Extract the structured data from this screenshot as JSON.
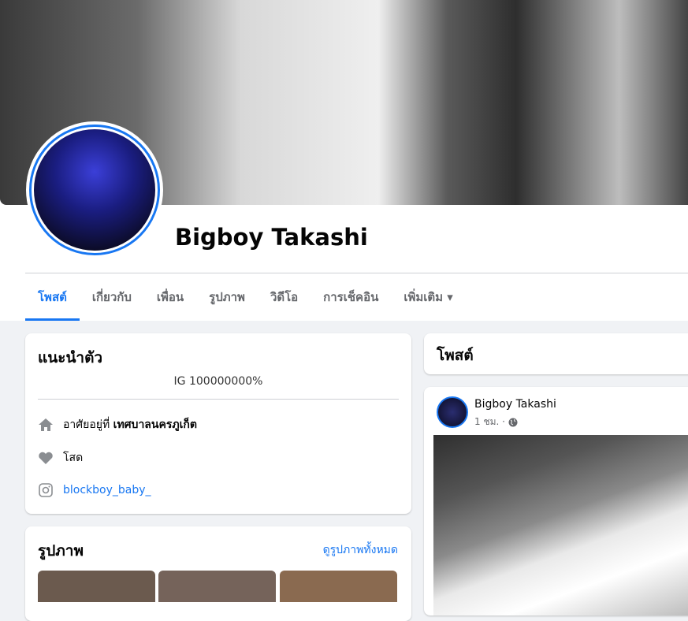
{
  "profile": {
    "name": "Bigboy Takashi"
  },
  "tabs": [
    {
      "label": "โพสต์"
    },
    {
      "label": "เกี่ยวกับ"
    },
    {
      "label": "เพื่อน"
    },
    {
      "label": "รูปภาพ"
    },
    {
      "label": "วิดีโอ"
    },
    {
      "label": "การเช็คอิน"
    },
    {
      "label": "เพิ่มเติม ▾"
    }
  ],
  "intro": {
    "title": "แนะนำตัว",
    "bio": "IG 100000000%",
    "lives_prefix": "อาศัยอยู่ที่ ",
    "lives_place": "เทศบาลนครภูเก็ต",
    "relationship": "โสด",
    "instagram": "blockboy_baby_"
  },
  "photos": {
    "title": "รูปภาพ",
    "see_all": "ดูรูปภาพทั้งหมด"
  },
  "posts": {
    "title": "โพสต์"
  },
  "post": {
    "author": "Bigboy Takashi",
    "time": "1 ชม. ·"
  },
  "colors": {
    "accent": "#1877f2"
  }
}
